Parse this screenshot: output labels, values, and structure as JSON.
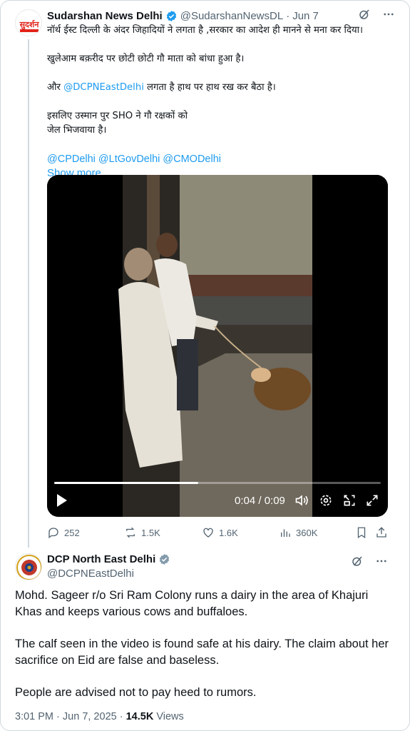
{
  "tweet1": {
    "author_name": "Sudarshan News Delhi",
    "handle": "@SudarshanNewsDL",
    "separator": "·",
    "date": "Jun 7",
    "avatar_text": "सुदर्शन",
    "lines": {
      "l1": "नॉर्थ ईस्ट दिल्ली के अंदर जिहादियों ने लगता है ,सरकार का आदेश ही मानने से मना कर दिया।",
      "l2": "खुलेआम बक़रीद पर छोटी छोटी गौ माता को बांधा हुआ है।",
      "l3_prefix": "और ",
      "l3_mention": "@DCPNEastDelhi",
      "l3_suffix": " लगता है हाथ पर हाथ रख कर बैठा है।",
      "l4": "इसलिए उस्मान पुर SHO ने गौ रक्षकों को",
      "l5": "जेल भिजवाया है।",
      "mentions": "@CPDelhi @LtGovDelhi @CMODelhi"
    },
    "show_more": "Show more",
    "video": {
      "time_label": "0:04 / 0:09",
      "progress": 0.44
    },
    "actions": {
      "replies": "252",
      "retweets": "1.5K",
      "likes": "1.6K",
      "views": "360K"
    }
  },
  "tweet2": {
    "author_name": "DCP North East Delhi",
    "handle": "@DCPNEastDelhi",
    "paragraphs": {
      "p1": "Mohd. Sageer r/o Sri Ram Colony runs a dairy in the area of Khajuri Khas and keeps various cows and buffaloes.",
      "p2": "The calf seen in the video is found safe at his dairy. The claim about her sacrifice on Eid are false and baseless.",
      "p3": "People are advised not to pay heed to rumors."
    },
    "time": "3:01 PM",
    "date": "Jun 7, 2025",
    "views_count": "14.5K",
    "views_label": "Views",
    "dot": "·"
  },
  "colors": {
    "accent": "#1d9bf0",
    "muted": "#536471",
    "text": "#0f1419",
    "verified": "#1d9bf0",
    "gov_verified": "#829aab",
    "brand_red": "#e2231a"
  },
  "icons": [
    "verified-badge-icon",
    "grok-icon",
    "more-icon",
    "play-icon",
    "volume-icon",
    "settings-icon",
    "pip-icon",
    "fullscreen-icon",
    "reply-icon",
    "retweet-icon",
    "like-icon",
    "views-icon",
    "bookmark-icon",
    "share-icon"
  ]
}
